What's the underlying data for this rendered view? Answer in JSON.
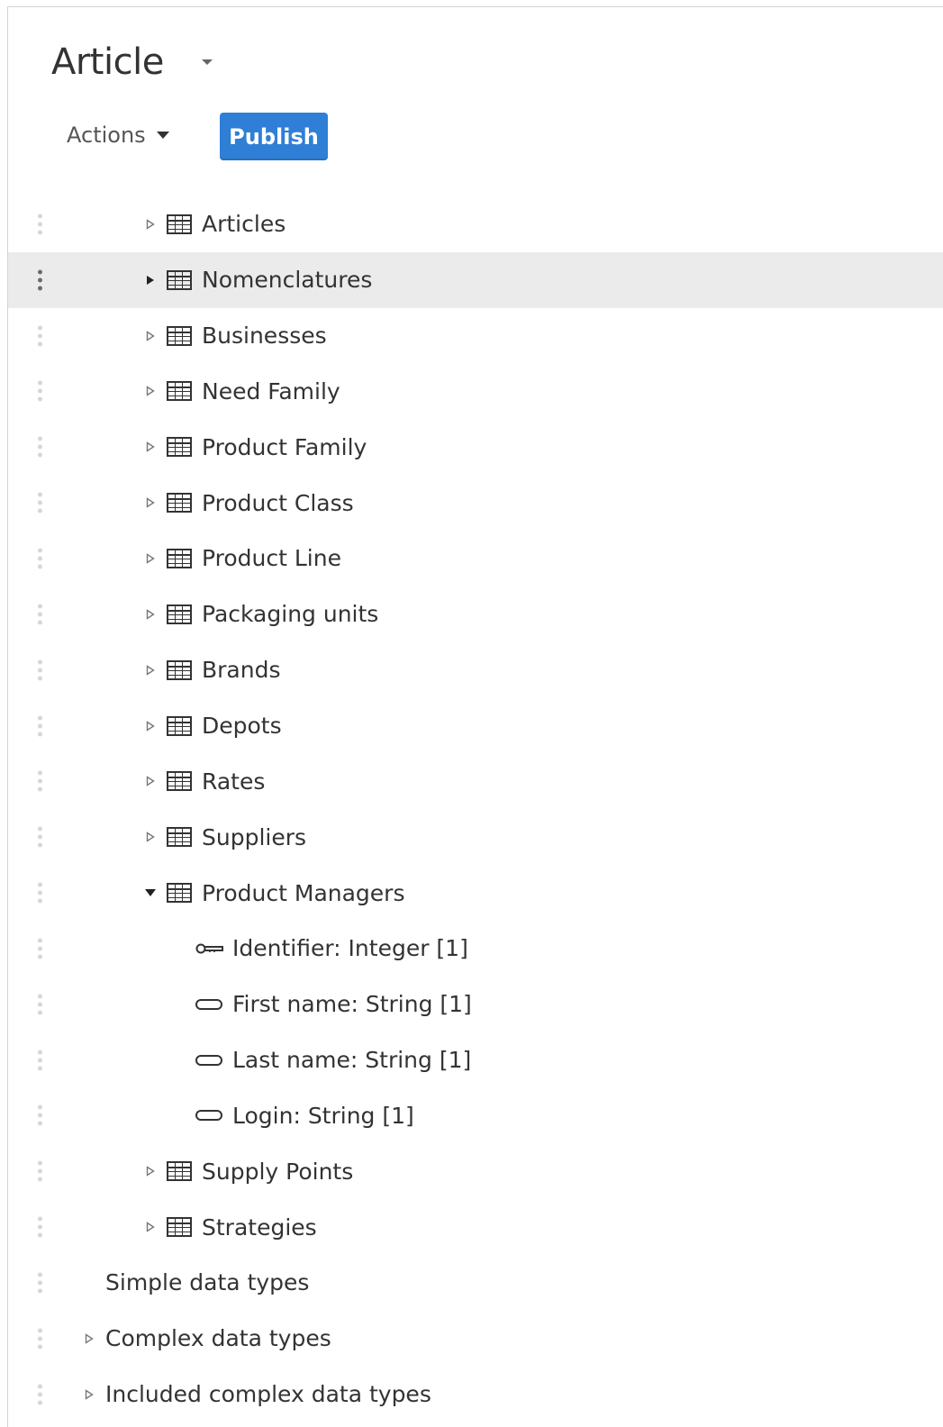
{
  "header": {
    "title": "Article",
    "actions_label": "Actions",
    "publish_label": "Publish"
  },
  "tree": [
    {
      "label": "Articles",
      "type": "table",
      "state": "collapsed",
      "selected": false
    },
    {
      "label": "Nomenclatures",
      "type": "table",
      "state": "collapsed",
      "selected": true
    },
    {
      "label": "Businesses",
      "type": "table",
      "state": "collapsed",
      "selected": false
    },
    {
      "label": "Need Family",
      "type": "table",
      "state": "collapsed",
      "selected": false
    },
    {
      "label": "Product Family",
      "type": "table",
      "state": "collapsed",
      "selected": false
    },
    {
      "label": "Product Class",
      "type": "table",
      "state": "collapsed",
      "selected": false
    },
    {
      "label": "Product Line",
      "type": "table",
      "state": "collapsed",
      "selected": false
    },
    {
      "label": "Packaging units",
      "type": "table",
      "state": "collapsed",
      "selected": false
    },
    {
      "label": "Brands",
      "type": "table",
      "state": "collapsed",
      "selected": false
    },
    {
      "label": "Depots",
      "type": "table",
      "state": "collapsed",
      "selected": false
    },
    {
      "label": "Rates",
      "type": "table",
      "state": "collapsed",
      "selected": false
    },
    {
      "label": "Suppliers",
      "type": "table",
      "state": "collapsed",
      "selected": false
    },
    {
      "label": "Product Managers",
      "type": "table",
      "state": "expanded",
      "selected": false
    },
    {
      "label": "Identifier: Integer  [1]",
      "type": "key-field",
      "state": "leaf",
      "selected": false
    },
    {
      "label": "First name: String  [1]",
      "type": "field",
      "state": "leaf",
      "selected": false
    },
    {
      "label": "Last name: String  [1]",
      "type": "field",
      "state": "leaf",
      "selected": false
    },
    {
      "label": "Login: String  [1]",
      "type": "field",
      "state": "leaf",
      "selected": false
    },
    {
      "label": "Supply Points",
      "type": "table",
      "state": "collapsed",
      "selected": false
    },
    {
      "label": "Strategies",
      "type": "table",
      "state": "collapsed",
      "selected": false
    },
    {
      "label": "Simple data types",
      "type": "group",
      "state": "leaf",
      "selected": false
    },
    {
      "label": "Complex data types",
      "type": "group",
      "state": "collapsed",
      "selected": false
    },
    {
      "label": "Included complex data types",
      "type": "group",
      "state": "collapsed",
      "selected": false
    }
  ],
  "icons": {
    "table": "table-icon",
    "key-field": "key-icon",
    "field": "field-icon",
    "drag": "drag-handle-icon"
  },
  "colors": {
    "publish_bg": "#2f7fd6",
    "selected_row_bg": "#ebebeb"
  }
}
